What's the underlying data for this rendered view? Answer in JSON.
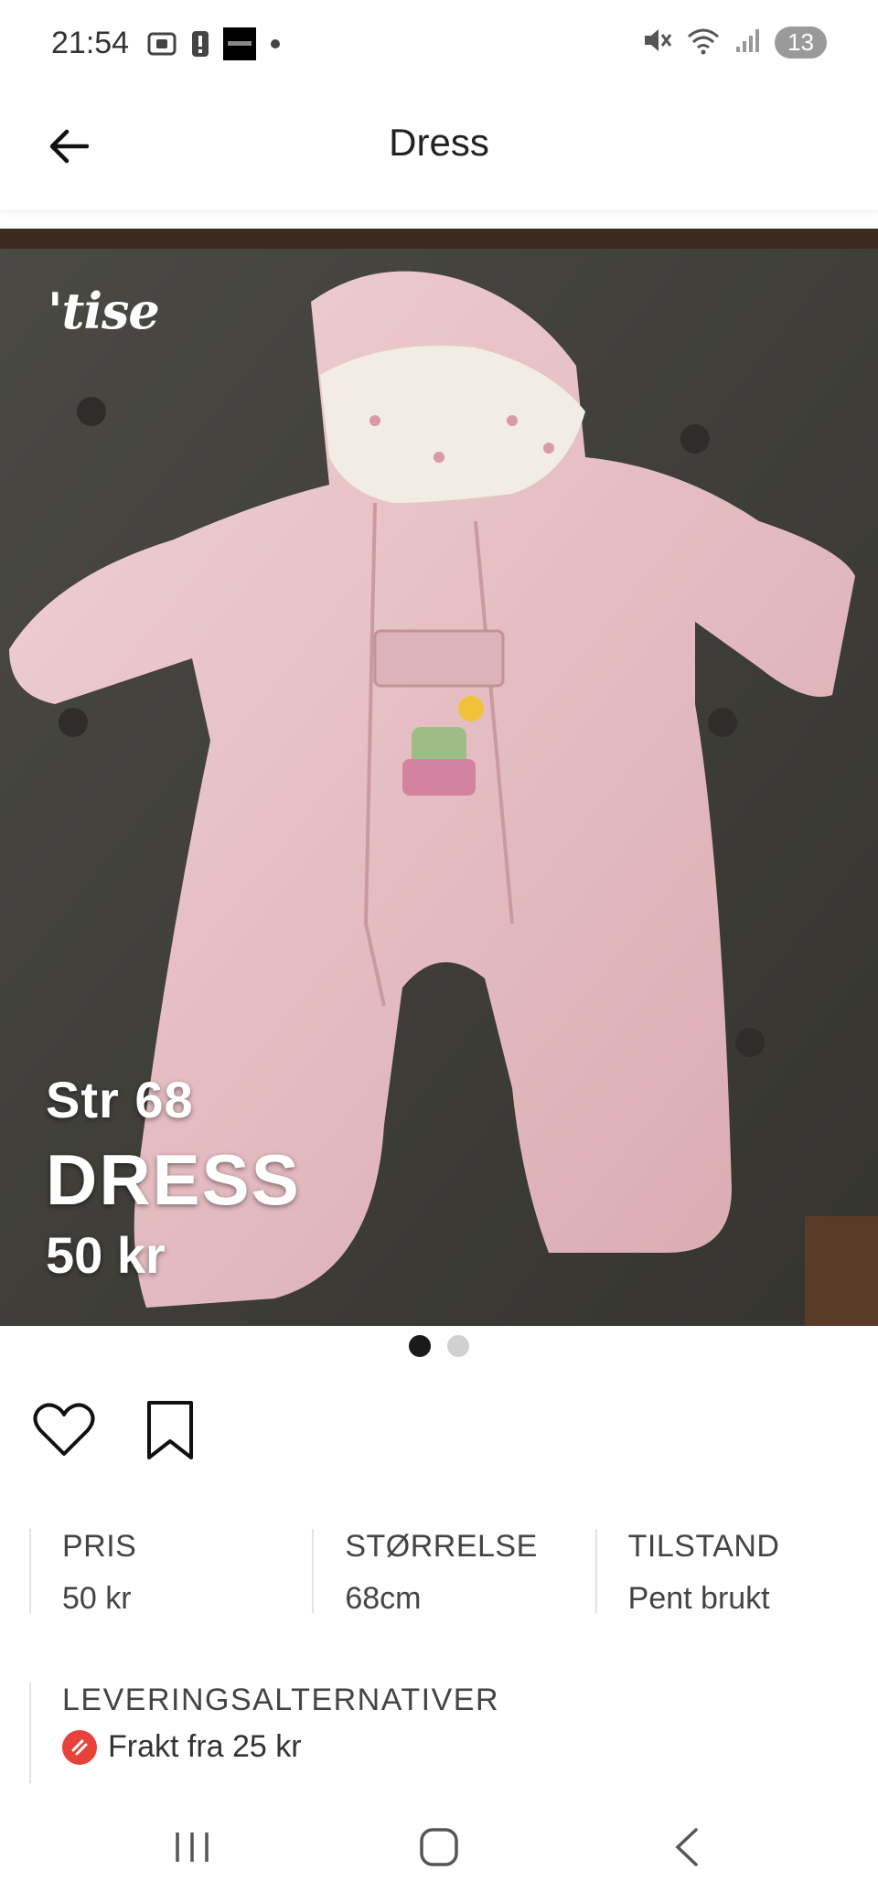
{
  "status_bar": {
    "time": "21:54",
    "notification_count": "13",
    "icons": [
      "screenshot-icon",
      "alert-icon",
      "app-thumbnail-icon",
      "dot-icon",
      "mute-icon",
      "wifi-icon",
      "signal-icon"
    ]
  },
  "header": {
    "title": "Dress",
    "back_icon": "arrow-left-icon"
  },
  "photo": {
    "watermark": "'tise",
    "size_text": "Str 68",
    "title_text": "DRESS",
    "price_text": "50 kr",
    "carousel": {
      "total": 2,
      "active": 1
    }
  },
  "actions": {
    "like_icon": "heart-icon",
    "save_icon": "bookmark-icon"
  },
  "details": {
    "price_label": "PRIS",
    "price_value": "50 kr",
    "size_label": "STØRRELSE",
    "size_value": "68cm",
    "condition_label": "TILSTAND",
    "condition_value": "Pent brukt"
  },
  "delivery": {
    "label": "LEVERINGSALTERNATIVER",
    "option": "Frakt fra 25 kr"
  },
  "navbar": {
    "icons": [
      "recent-apps-icon",
      "home-icon",
      "back-icon"
    ]
  },
  "colors": {
    "accent_red": "#e8413a",
    "garment_pink": "#e9c3c8",
    "background_grey": "#3f3e3a"
  }
}
